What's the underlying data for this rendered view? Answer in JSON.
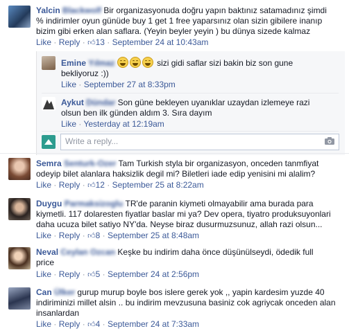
{
  "labels": {
    "like": "Like",
    "reply": "Reply",
    "dot": "·"
  },
  "comments": [
    {
      "name_first": "Yalcin",
      "name_last": "Blackwolf",
      "text_line1": "Bir organizasyonuda doğru yapın baktınız satamadınız şimdi",
      "text_line2": "% indirimler oyun günüde buy 1 get 1 free yaparsınız olan sizin gibilere inanıp",
      "text_line3": "bizim gibi erken alan saflara. (Yeyin beyler yeyin ) bu dünya sizede kalmaz",
      "likes": "13",
      "time": "September 24 at 10:43am"
    },
    {
      "name_first": "Emine",
      "name_last": "Yılmaz",
      "text_line1": "sizi gidi saflar sizi bakin biz son gune",
      "text_line2": "bekliyoruz :))",
      "time": "September 27 at 8:33pm"
    },
    {
      "name_first": "Aykut",
      "name_last": "Dündar",
      "text_line1": "Son güne bekleyen uyanıklar uzaydan izlemeye razi",
      "text_line2": "olsun ben ilk günden aldım 3. Sıra dayım",
      "time": "Yesterday at 12:19am"
    },
    {
      "name_first": "Semra",
      "name_last": "Senturk-Ozer",
      "text_line1": "Tam Turkish styla bir organizasyon, onceden tanmfiyat",
      "text_line2": "odeyip bilet alanlara haksizlik degil mi? Biletleri iade edip yenisini mi alalim?",
      "likes": "12",
      "time": "September 25 at 8:22am"
    },
    {
      "name_first": "Duygu",
      "name_last": "Parmaksizoglu",
      "text_line1": "TR'de paranin kiymeti olmayabilir ama burada para",
      "text_line2": "kiymetli. 117 dolaresten fiyatlar baslar mi ya? Dev opera, tiyatro produksuyonlari",
      "text_line3": "daha ucuza bilet satiyo NY'da. Neyse biraz dusurmuzsunuz, allah razi olsun...",
      "likes": "8",
      "time": "September 25 at 8:48am"
    },
    {
      "name_first": "Neval",
      "name_last": "Ceylan Ozcan",
      "text_line1": "Keşke bu indirim daha önce düşünülseydi, ödedik full",
      "text_line2": "price",
      "likes": "5",
      "time": "September 24 at 2:56pm"
    },
    {
      "name_first": "Can",
      "name_last": "Ülker",
      "text_line1": "gurup murup boyle bos islere gerek yok ,, yapin kardesim yuzde 40",
      "text_line2": "indiriminizi millet alsin .. bu indirim mevzusuna basiniz cok agriycak onceden alan",
      "text_line3": "insanlardan",
      "likes": "4",
      "time": "September 24 at 7:33am"
    }
  ],
  "reply_box": {
    "placeholder": "Write a reply..."
  },
  "icons": {
    "like": "thumbs-up-icon",
    "camera": "camera-icon",
    "emoji": "laughing-face-icon"
  },
  "colors": {
    "link": "#3b5998",
    "meta": "#9197a3",
    "reply_bg": "#f6f7f9"
  }
}
